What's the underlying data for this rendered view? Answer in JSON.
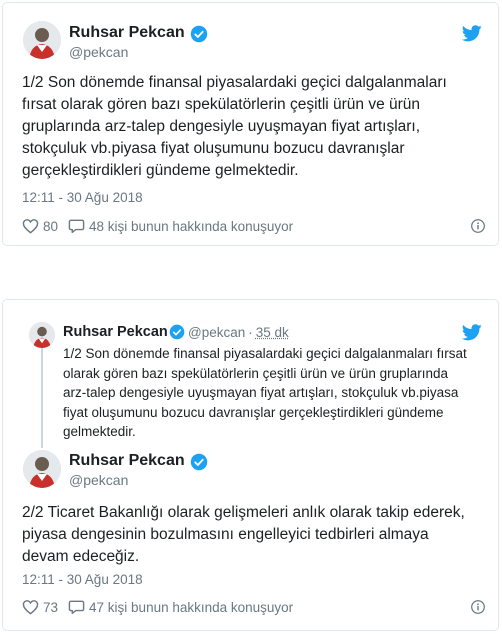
{
  "tweet1": {
    "author": {
      "name": "Ruhsar Pekcan",
      "handle": "@pekcan"
    },
    "text_lines": [
      "1/2 Son dönemde finansal piyasalardaki geçici dalgalanmaları",
      "fırsat olarak gören bazı spekülatörlerin çeşitli ürün ve ürün",
      "gruplarında  arz-talep dengesiyle uyuşmayan  fiyat artışları,",
      "stokçuluk vb.piyasa fiyat oluşumunu bozucu davranışlar",
      "gerçekleştirdikleri gündeme gelmektedir."
    ],
    "timestamp": "12:11 - 30 Ağu 2018",
    "likes": "80",
    "replies_text": "48 kişi bunun hakkında konuşuyor"
  },
  "tweet2": {
    "quoted": {
      "name": "Ruhsar Pekcan",
      "handle": "@pekcan",
      "separator": "·",
      "time": "35 dk",
      "text_lines": [
        "1/2 Son dönemde finansal piyasalardaki geçici dalgalanmaları fırsat",
        "olarak gören bazı spekülatörlerin çeşitli ürün ve ürün gruplarında",
        "arz-talep dengesiyle uyuşmayan  fiyat artışları, stokçuluk vb.piyasa",
        "fiyat oluşumunu bozucu davranışlar gerçekleştirdikleri gündeme",
        "gelmektedir."
      ]
    },
    "author": {
      "name": "Ruhsar Pekcan",
      "handle": "@pekcan"
    },
    "text_lines": [
      "2/2 Ticaret Bakanlığı olarak gelişmeleri anlık olarak takip ederek,",
      "piyasa dengesinin bozulmasını engelleyici tedbirleri almaya",
      "devam edeceğiz."
    ],
    "timestamp": "12:11 - 30 Ağu 2018",
    "likes": "73",
    "replies_text": "47 kişi bunun hakkında konuşuyor"
  },
  "icons": {
    "verified": "verified-badge-icon",
    "twitter": "twitter-bird-icon",
    "like": "heart-icon",
    "reply": "speech-bubble-icon",
    "info": "info-icon"
  },
  "colors": {
    "twitter_blue": "#1da1f2",
    "muted": "#697882",
    "text": "#1c2022",
    "border": "#e1e8ed"
  }
}
